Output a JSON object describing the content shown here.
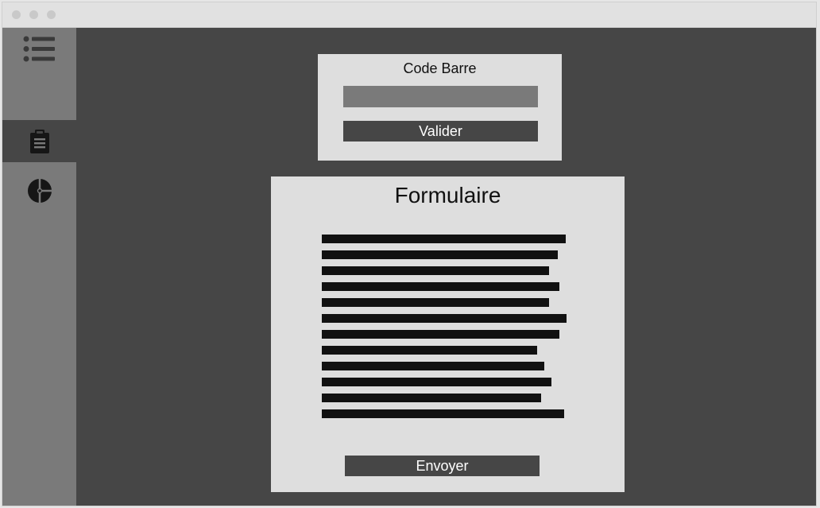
{
  "window": {
    "traffic_lights": [
      "close",
      "minimize",
      "zoom"
    ]
  },
  "sidebar": {
    "items": [
      {
        "name": "list",
        "icon": "list-icon",
        "active": false
      },
      {
        "name": "clipboard",
        "icon": "clipboard-icon",
        "active": true
      },
      {
        "name": "chart",
        "icon": "pie-chart-icon",
        "active": false
      }
    ]
  },
  "barcode": {
    "title": "Code Barre",
    "input_value": "",
    "validate_label": "Valider"
  },
  "form": {
    "title": "Formulaire",
    "line_count": 12,
    "send_label": "Envoyer"
  },
  "colors": {
    "background": "#464646",
    "sidebar": "#7a7a7a",
    "panel": "#dedede",
    "button": "#464646",
    "text_placeholder": "#111111"
  }
}
